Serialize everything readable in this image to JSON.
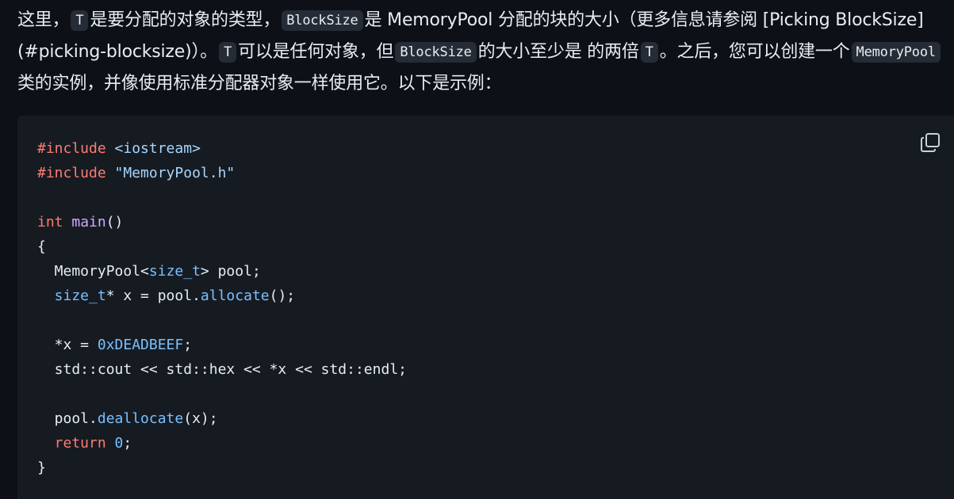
{
  "prose": {
    "t1": "这里，",
    "c1": "T",
    "t2": "是要分配的对象的类型，",
    "c2": "BlockSize",
    "t3": "是 MemoryPool 分配的块的大小（更多信息请参阅 [Picking BlockSize] (#picking-blocksize)）。",
    "c3": "T",
    "t4": "可以是任何对象，但",
    "c4": "BlockSize",
    "t5": "的大小至少是 的两倍",
    "c5": "T",
    "t6": "。之后，您可以创建一个",
    "c6": "MemoryPool",
    "t7": "类的实例，并像使用标准分配器对象一样使用它。以下是示例："
  },
  "code": {
    "l1": {
      "kw": "#include",
      "rest": " <iostream>"
    },
    "l2": {
      "kw": "#include",
      "rest": " \"MemoryPool.h\""
    },
    "l3": {
      "kw": "int",
      "fn": "main",
      "rest": "()"
    },
    "l4": "{",
    "l5": {
      "pre": "  MemoryPool<",
      "ty": "size_t",
      "post": "> pool;"
    },
    "l6": {
      "ty": "  size_t",
      "mid": "* x = pool.",
      "fn": "allocate",
      "post": "();"
    },
    "l7": {
      "pre": "  *x = ",
      "num": "0xDEADBEEF",
      "post": ";"
    },
    "l8": "  std::cout << std::hex << *x << std::endl;",
    "l9": {
      "pre": "  pool.",
      "fn": "deallocate",
      "post": "(x);"
    },
    "l10": {
      "kw": "  return",
      "sp": " ",
      "num": "0",
      "post": ";"
    },
    "l11": "}"
  },
  "icons": {
    "copy": "copy-icon"
  },
  "colors": {
    "page_bg": "#0d1117",
    "code_bg": "#161b22",
    "keyword": "#ff7b72",
    "string": "#a5d6ff",
    "function": "#d2a8ff",
    "type": "#79c0ff"
  }
}
